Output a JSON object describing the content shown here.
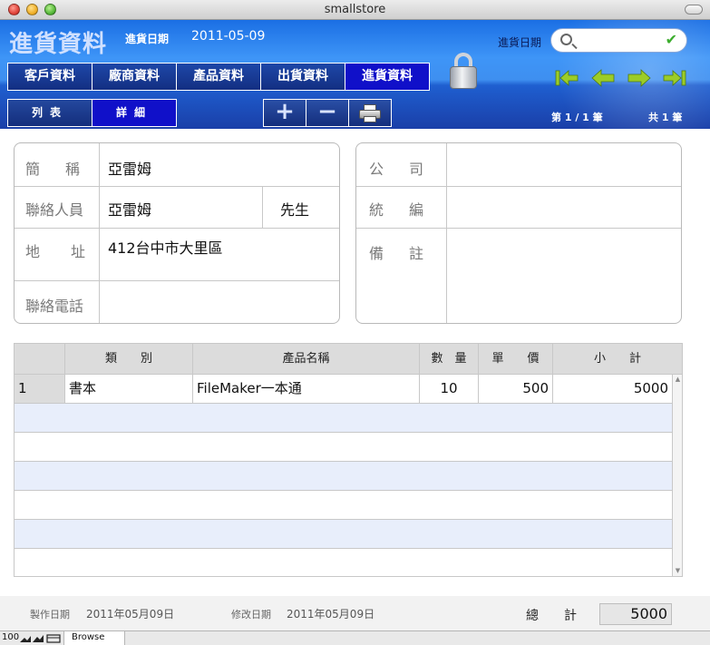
{
  "window": {
    "title": "smallstore"
  },
  "header": {
    "app_title": "進貨資料",
    "date_label": "進貨日期",
    "date_value": "2011-05-09",
    "search_label": "進貨日期",
    "search_value": "",
    "tabs": [
      {
        "label": "客戶資料"
      },
      {
        "label": "廠商資料"
      },
      {
        "label": "產品資料"
      },
      {
        "label": "出貨資料"
      },
      {
        "label": "進貨資料",
        "active": true
      }
    ],
    "view_tabs": [
      {
        "label": "列表"
      },
      {
        "label": "詳細",
        "active": true
      }
    ],
    "tools": {
      "add": "+",
      "delete": "−"
    },
    "record_position": "第 1 / 1 筆",
    "record_total": "共 1 筆",
    "nav_icons": [
      "first-record-icon",
      "prev-record-icon",
      "next-record-icon",
      "last-record-icon"
    ],
    "accent_colors": {
      "header_blue": "#3e95f7",
      "active_tab": "#1010c9",
      "nav_green": "#9ccc28"
    }
  },
  "vendor": {
    "short_name_label": "簡稱",
    "short_name": "亞雷姆",
    "contact_label": "聯絡人員",
    "contact": "亞雷姆",
    "title": "先生",
    "address_label": "地址",
    "address": "412台中市大里區",
    "phone_label": "聯絡電話",
    "phone": ""
  },
  "company": {
    "company_label": "公司",
    "company": "",
    "tax_id_label": "統編",
    "tax_id": "",
    "note_label": "備註",
    "note": ""
  },
  "items_table": {
    "columns": [
      "",
      "類　　別",
      "產品名稱",
      "數　量",
      "單　　價",
      "小　　計"
    ],
    "rows": [
      [
        "1",
        "書本",
        "FileMaker一本通",
        "10",
        "500",
        "5000"
      ]
    ]
  },
  "footer": {
    "created_label": "製作日期",
    "created": "2011年05月09日",
    "modified_label": "修改日期",
    "modified": "2011年05月09日",
    "total_label": "總計",
    "total": "5000"
  },
  "status": {
    "zoom": "100",
    "mode": "Browse"
  }
}
